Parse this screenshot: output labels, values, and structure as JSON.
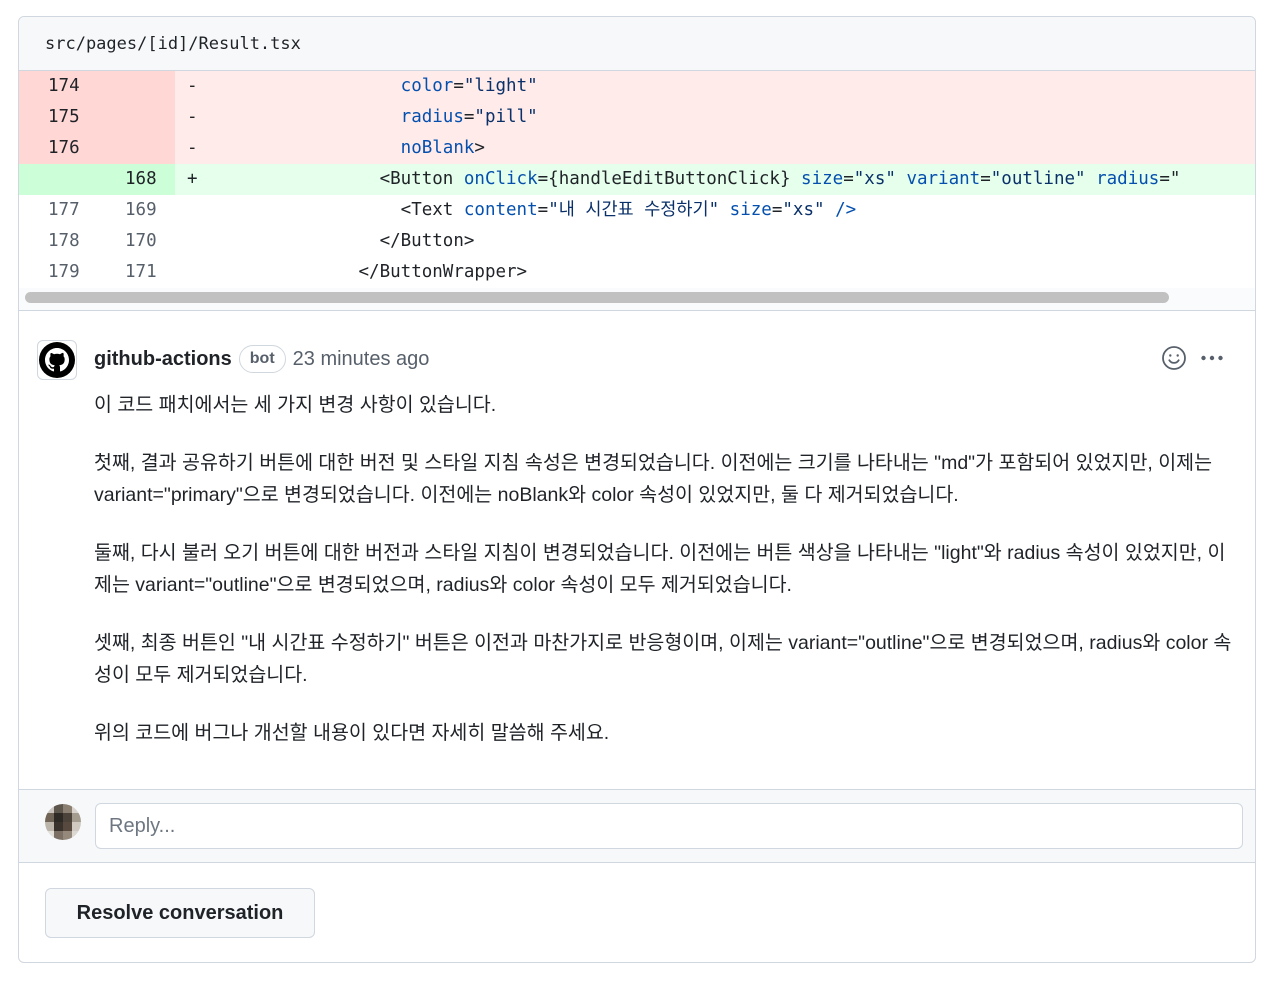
{
  "file": {
    "path": "src/pages/[id]/Result.tsx"
  },
  "diff": {
    "rows": [
      {
        "type": "del",
        "old": "174",
        "new": "",
        "marker": "-",
        "tokens": [
          {
            "t": "                  ",
            "c": "plain"
          },
          {
            "t": "color",
            "c": "attr"
          },
          {
            "t": "=",
            "c": "plain"
          },
          {
            "t": "\"light\"",
            "c": "str"
          }
        ]
      },
      {
        "type": "del",
        "old": "175",
        "new": "",
        "marker": "-",
        "tokens": [
          {
            "t": "                  ",
            "c": "plain"
          },
          {
            "t": "radius",
            "c": "attr"
          },
          {
            "t": "=",
            "c": "plain"
          },
          {
            "t": "\"pill\"",
            "c": "str"
          }
        ]
      },
      {
        "type": "del",
        "old": "176",
        "new": "",
        "marker": "-",
        "tokens": [
          {
            "t": "                  ",
            "c": "plain"
          },
          {
            "t": "noBlank",
            "c": "attr"
          },
          {
            "t": ">",
            "c": "plain"
          }
        ]
      },
      {
        "type": "add",
        "old": "",
        "new": "168",
        "marker": "+",
        "tokens": [
          {
            "t": "                ",
            "c": "plain"
          },
          {
            "t": "<Button ",
            "c": "plain"
          },
          {
            "t": "onClick",
            "c": "attr"
          },
          {
            "t": "={handleEditButtonClick} ",
            "c": "plain"
          },
          {
            "t": "size",
            "c": "attr"
          },
          {
            "t": "=",
            "c": "plain"
          },
          {
            "t": "\"xs\" ",
            "c": "str"
          },
          {
            "t": "variant",
            "c": "attr"
          },
          {
            "t": "=",
            "c": "plain"
          },
          {
            "t": "\"outline\" ",
            "c": "str"
          },
          {
            "t": "radius",
            "c": "attr"
          },
          {
            "t": "=\"",
            "c": "plain"
          }
        ]
      },
      {
        "type": "ctx",
        "old": "177",
        "new": "169",
        "marker": "",
        "tokens": [
          {
            "t": "                  ",
            "c": "plain"
          },
          {
            "t": "<Text ",
            "c": "plain"
          },
          {
            "t": "content",
            "c": "attr"
          },
          {
            "t": "=",
            "c": "plain"
          },
          {
            "t": "\"내 시간표 수정하기\" ",
            "c": "str"
          },
          {
            "t": "size",
            "c": "attr"
          },
          {
            "t": "=",
            "c": "plain"
          },
          {
            "t": "\"xs\" ",
            "c": "str"
          },
          {
            "t": "/>",
            "c": "attr"
          }
        ]
      },
      {
        "type": "ctx",
        "old": "178",
        "new": "170",
        "marker": "",
        "tokens": [
          {
            "t": "                ",
            "c": "plain"
          },
          {
            "t": "</Button>",
            "c": "plain"
          }
        ]
      },
      {
        "type": "ctx",
        "old": "179",
        "new": "171",
        "marker": "",
        "tokens": [
          {
            "t": "              ",
            "c": "plain"
          },
          {
            "t": "</ButtonWrapper>",
            "c": "plain"
          }
        ]
      }
    ]
  },
  "comment": {
    "author": "github-actions",
    "badge": "bot",
    "time": "23 minutes ago",
    "avatar_icon": "github-mark-icon",
    "paragraphs": [
      "이 코드 패치에서는 세 가지 변경 사항이 있습니다.",
      "첫째, 결과 공유하기 버튼에 대한 버전 및 스타일 지침 속성은 변경되었습니다. 이전에는 크기를 나타내는 \"md\"가 포함되어 있었지만, 이제는 variant=\"primary\"으로 변경되었습니다. 이전에는 noBlank와 color 속성이 있었지만, 둘 다 제거되었습니다.",
      "둘째, 다시 불러 오기 버튼에 대한 버전과 스타일 지침이 변경되었습니다. 이전에는 버튼 색상을 나타내는 \"light\"와 radius 속성이 있었지만, 이제는 variant=\"outline\"으로 변경되었으며, radius와 color 속성이 모두 제거되었습니다.",
      "셋째, 최종 버튼인 \"내 시간표 수정하기\" 버튼은 이전과 마찬가지로 반응형이며, 이제는 variant=\"outline\"으로 변경되었으며, radius와 color 속성이 모두 제거되었습니다.",
      "위의 코드에 버그나 개선할 내용이 있다면 자세히 말씀해 주세요."
    ]
  },
  "reply": {
    "placeholder": "Reply..."
  },
  "actions": {
    "resolve_label": "Resolve conversation"
  },
  "colors": {
    "del_bg": "#ffebe9",
    "add_bg": "#e6ffec",
    "attr": "#0550ae",
    "str": "#0a3069"
  }
}
